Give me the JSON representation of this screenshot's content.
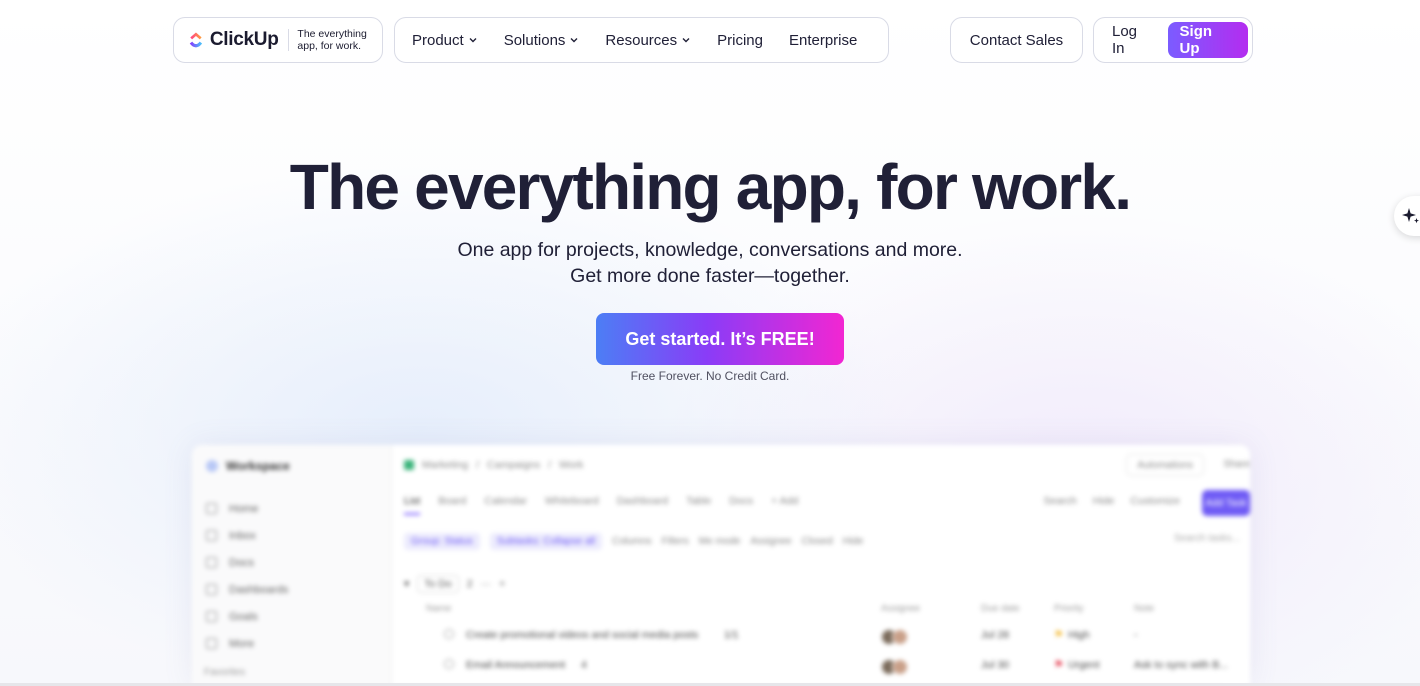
{
  "brand": {
    "name": "ClickUp",
    "tagline": "The everything app, for work."
  },
  "nav": {
    "menu": [
      {
        "label": "Product",
        "dropdown": true
      },
      {
        "label": "Solutions",
        "dropdown": true
      },
      {
        "label": "Resources",
        "dropdown": true
      },
      {
        "label": "Pricing",
        "dropdown": false
      },
      {
        "label": "Enterprise",
        "dropdown": false
      }
    ],
    "contact_sales": "Contact Sales",
    "login": "Log In",
    "signup": "Sign Up"
  },
  "hero": {
    "title": "The everything app, for work.",
    "subtitle_line1": "One app for projects, knowledge, conversations and more.",
    "subtitle_line2": "Get more done faster—together.",
    "cta": "Get started. It’s FREE!",
    "cta_note": "Free Forever. No Credit Card."
  },
  "ai_button": {
    "icon": "sparkle-icon"
  },
  "preview": {
    "workspace": "Workspace",
    "sidebar": [
      "Home",
      "Inbox",
      "Docs",
      "Dashboards",
      "Goals",
      "More"
    ],
    "favorites": "Favorites",
    "breadcrumb": [
      "Marketing",
      "Campaigns",
      "Work"
    ],
    "automations": "Automations",
    "share": "Share",
    "tabs": [
      "List",
      "Board",
      "Calendar",
      "Whiteboard",
      "Dashboard",
      "Table",
      "Docs",
      "+ Add"
    ],
    "tools": [
      "Search",
      "Hide",
      "Customize"
    ],
    "add_task": "Add Task",
    "filters": [
      "Group: Status",
      "Subtasks: Collapse all",
      "Columns",
      "Filters",
      "Me mode",
      "Assignee",
      "Closed",
      "Hide"
    ],
    "search_placeholder": "Search tasks...",
    "group_label": "To Do",
    "group_count": "2",
    "columns": [
      "Name",
      "Assignee",
      "Due date",
      "Priority",
      "Note"
    ],
    "rows": [
      {
        "name": "Create promotional videos and social media posts",
        "meta": "1/1",
        "due": "Jul 28",
        "priority": "High",
        "note": "-"
      },
      {
        "name": "Email Announcement",
        "meta": "4",
        "due": "Jul 30",
        "priority": "Urgent",
        "note": "Ask to sync with B..."
      }
    ]
  },
  "colors": {
    "text": "#202037",
    "signup_gradient": [
      "#7b5cff",
      "#b42cf0"
    ],
    "cta_gradient": [
      "#4c7ef5",
      "#8a3cf7",
      "#f226d2"
    ]
  }
}
